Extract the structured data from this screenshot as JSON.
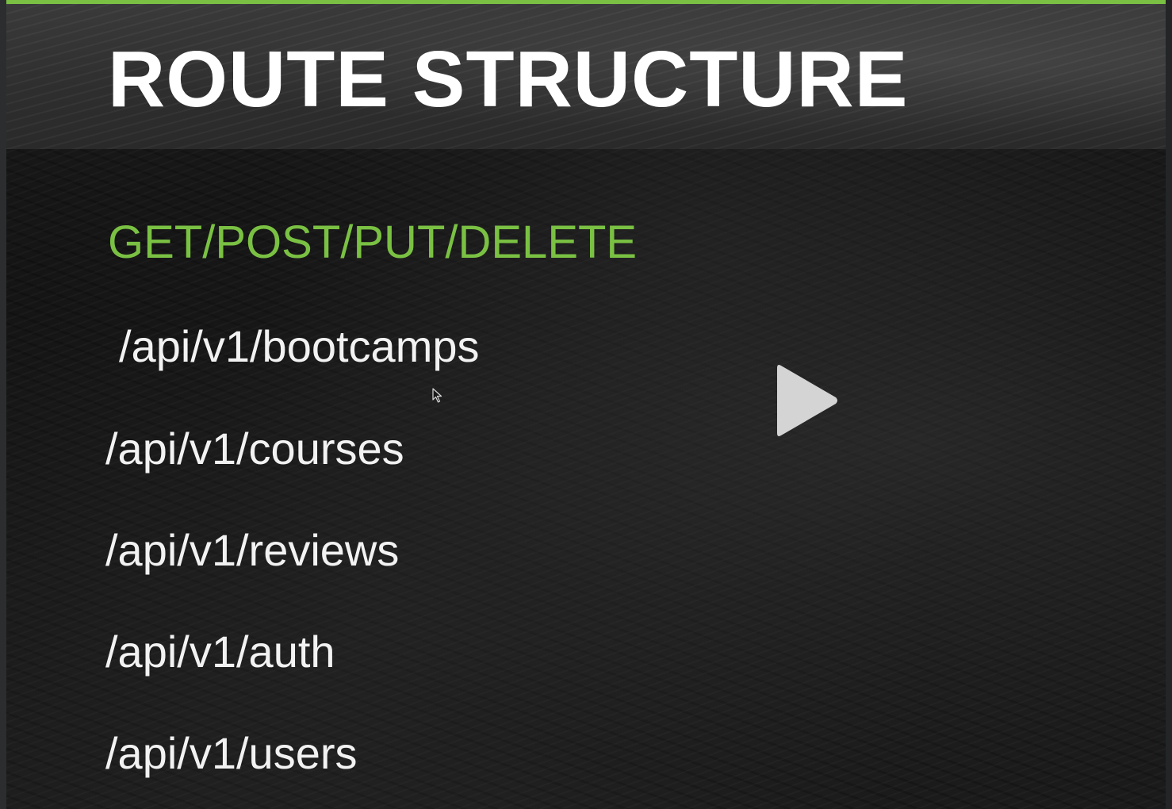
{
  "slide": {
    "title": "ROUTE STRUCTURE",
    "methods": "GET/POST/PUT/DELETE",
    "routes": [
      "/api/v1/bootcamps",
      "/api/v1/courses",
      "/api/v1/reviews",
      "/api/v1/auth",
      "/api/v1/users"
    ]
  },
  "player": {
    "play_icon": "play-icon",
    "cursor_icon": "mouse-pointer-icon"
  },
  "colors": {
    "accent": "#7ac143",
    "title": "#ffffff",
    "route_text": "#f2f2f2",
    "background": "#151515"
  }
}
